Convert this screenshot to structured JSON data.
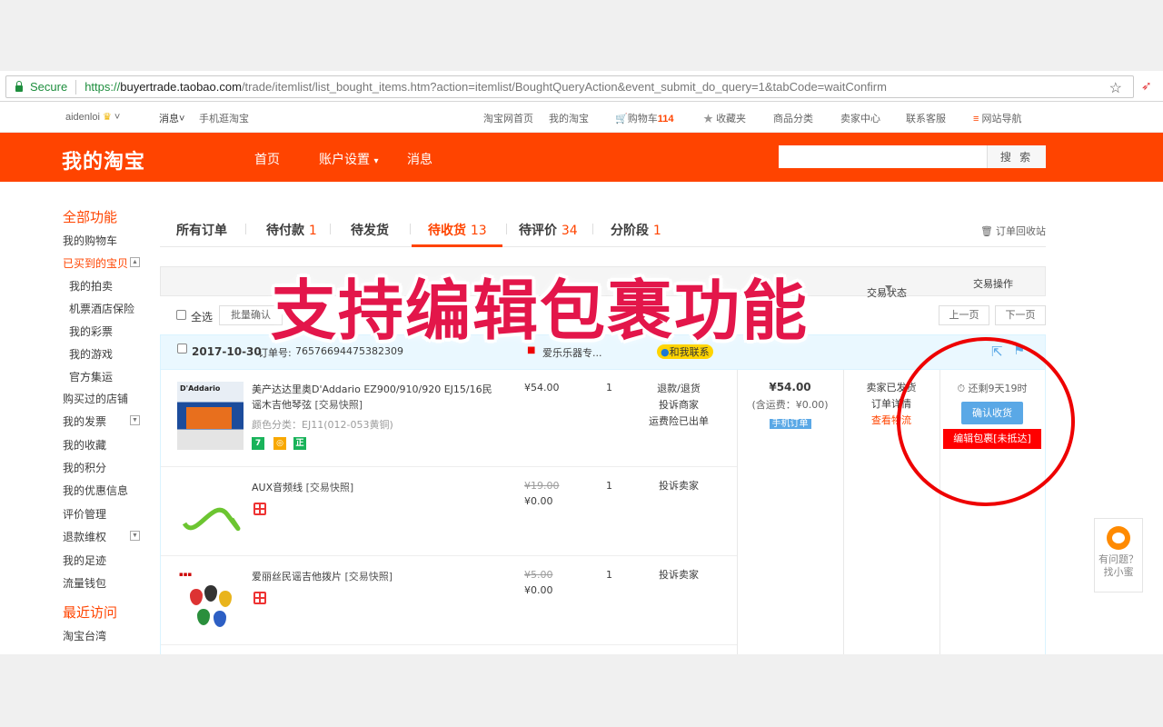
{
  "browser": {
    "secure_label": "Secure",
    "url_scheme": "https://",
    "url_host": "buyertrade.taobao.com",
    "url_path": "/trade/itemlist/list_bought_items.htm?action=itemlist/BoughtQueryAction&event_submit_do_query=1&tabCode=waitConfirm"
  },
  "sitenav": {
    "user": "aidenloi",
    "messages": "消息",
    "mobile": "手机逛淘宝",
    "home": "淘宝网首页",
    "my_taobao": "我的淘宝",
    "cart_label": "购物车",
    "cart_count": "114",
    "favorites": "收藏夹",
    "categories": "商品分类",
    "seller": "卖家中心",
    "service": "联系客服",
    "sitemap": "网站导航"
  },
  "header": {
    "logo": "我的淘宝",
    "nav": [
      "首页",
      "账户设置",
      "消息"
    ],
    "search_button": "搜 索"
  },
  "sidebar": {
    "title": "全部功能",
    "items": [
      {
        "label": "我的购物车"
      },
      {
        "label": "已买到的宝贝"
      },
      {
        "label": "我的拍卖"
      },
      {
        "label": "机票酒店保险"
      },
      {
        "label": "我的彩票"
      },
      {
        "label": "我的游戏"
      },
      {
        "label": "官方集运"
      },
      {
        "label": "购买过的店铺"
      },
      {
        "label": "我的发票"
      },
      {
        "label": "我的收藏"
      },
      {
        "label": "我的积分"
      },
      {
        "label": "我的优惠信息"
      },
      {
        "label": "评价管理"
      },
      {
        "label": "退款维权"
      },
      {
        "label": "我的足迹"
      },
      {
        "label": "流量钱包"
      }
    ],
    "recent_title": "最近访问",
    "recent_items": [
      "淘宝台湾"
    ]
  },
  "tabs": [
    {
      "label": "所有订单",
      "count": ""
    },
    {
      "label": "待付款",
      "count": "1"
    },
    {
      "label": "待发货",
      "count": ""
    },
    {
      "label": "待收货",
      "count": "13"
    },
    {
      "label": "待评价",
      "count": "34"
    },
    {
      "label": "分阶段",
      "count": "1"
    }
  ],
  "recycle_bin": "订单回收站",
  "table_header": {
    "status": "交易状态",
    "action": "交易操作"
  },
  "toolbar": {
    "select_all": "全选",
    "batch_confirm": "批量确认",
    "prev_page": "上一页",
    "next_page": "下一页"
  },
  "order": {
    "date": "2017-10-30",
    "order_no_label": "订单号:",
    "order_no": "76576694475382309",
    "shop": "爱乐乐器专...",
    "contact": "和我联系",
    "items": [
      {
        "name": "美产达达里奥D'Addario EZ900/910/920 EJ15/16民谣木吉他琴弦",
        "snapshot": "[交易快照]",
        "sku": "颜色分类：EJ11(012-053黄铜)",
        "price": "¥54.00",
        "old_price": "",
        "qty": "1",
        "ops": [
          "退款/退货",
          "投诉商家",
          "运费险已出单"
        ]
      },
      {
        "name": "AUX音频线",
        "snapshot": "[交易快照]",
        "sku": "",
        "price": "¥0.00",
        "old_price": "¥19.00",
        "qty": "1",
        "ops": [
          "投诉卖家"
        ]
      },
      {
        "name": "爱丽丝民谣吉他拨片",
        "snapshot": "[交易快照]",
        "sku": "",
        "price": "¥0.00",
        "old_price": "¥5.00",
        "qty": "1",
        "ops": [
          "投诉卖家"
        ]
      }
    ],
    "total": "¥54.00",
    "shipping": "(含运费：¥0.00)",
    "mobile_order": "手机订单",
    "status_lines": [
      "卖家已发货",
      "订单详情",
      "查看物流"
    ],
    "remaining": "还剩9天19时",
    "confirm_button": "确认收货",
    "edit_package_button": "编辑包裹[未抵达]"
  },
  "overlay_caption": "支持编辑包裹功能",
  "help_widget": {
    "line1": "有问题？",
    "line2": "找小蜜"
  },
  "colors": {
    "brand": "#ff4400",
    "confirm": "#5aa8e6",
    "edit": "#ff0000",
    "caption": "#e3164a"
  }
}
